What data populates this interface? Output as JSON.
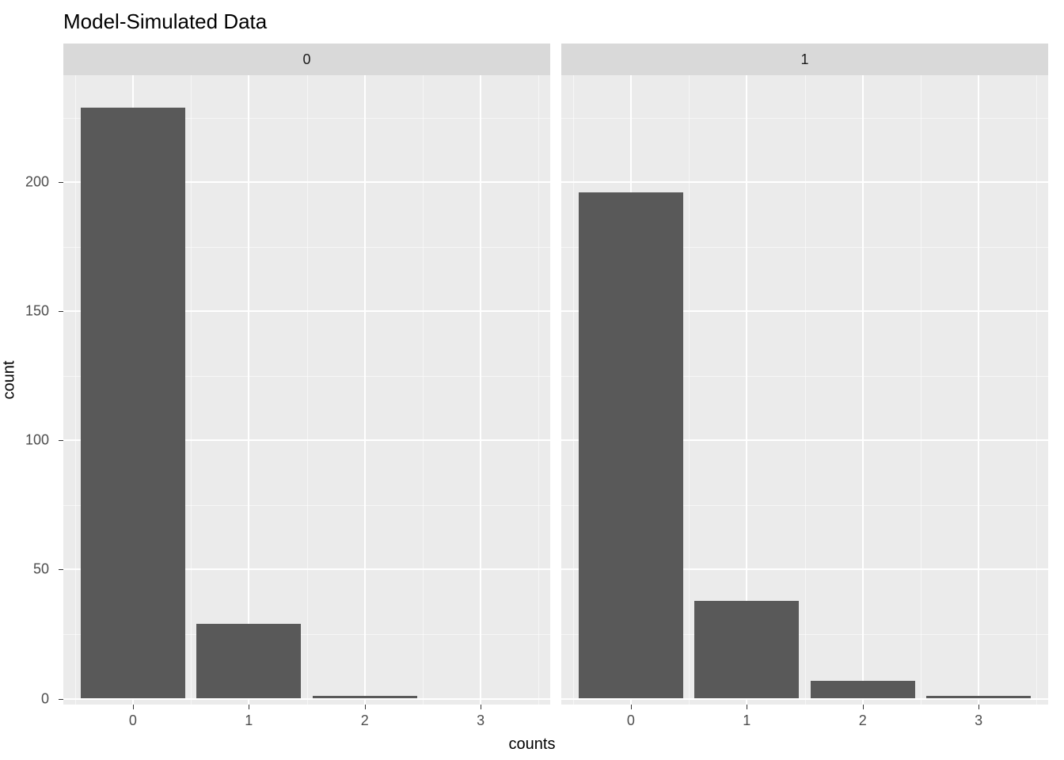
{
  "chart_data": {
    "type": "bar",
    "title": "Model-Simulated Data",
    "xlabel": "counts",
    "ylabel": "count",
    "ylim": [
      0,
      230
    ],
    "y_ticks": [
      0,
      50,
      100,
      150,
      200
    ],
    "x_ticks": [
      0,
      1,
      2,
      3
    ],
    "x_range": [
      -0.6,
      3.6
    ],
    "facets": [
      {
        "label": "0",
        "categories": [
          0,
          1,
          2,
          3
        ],
        "values": [
          229,
          29,
          1,
          0
        ]
      },
      {
        "label": "1",
        "categories": [
          0,
          1,
          2,
          3
        ],
        "values": [
          196,
          38,
          7,
          1
        ]
      }
    ],
    "bar_fill": "#595959",
    "panel_bg": "#ebebeb",
    "strip_bg": "#d9d9d9",
    "grid_color": "#ffffff"
  }
}
